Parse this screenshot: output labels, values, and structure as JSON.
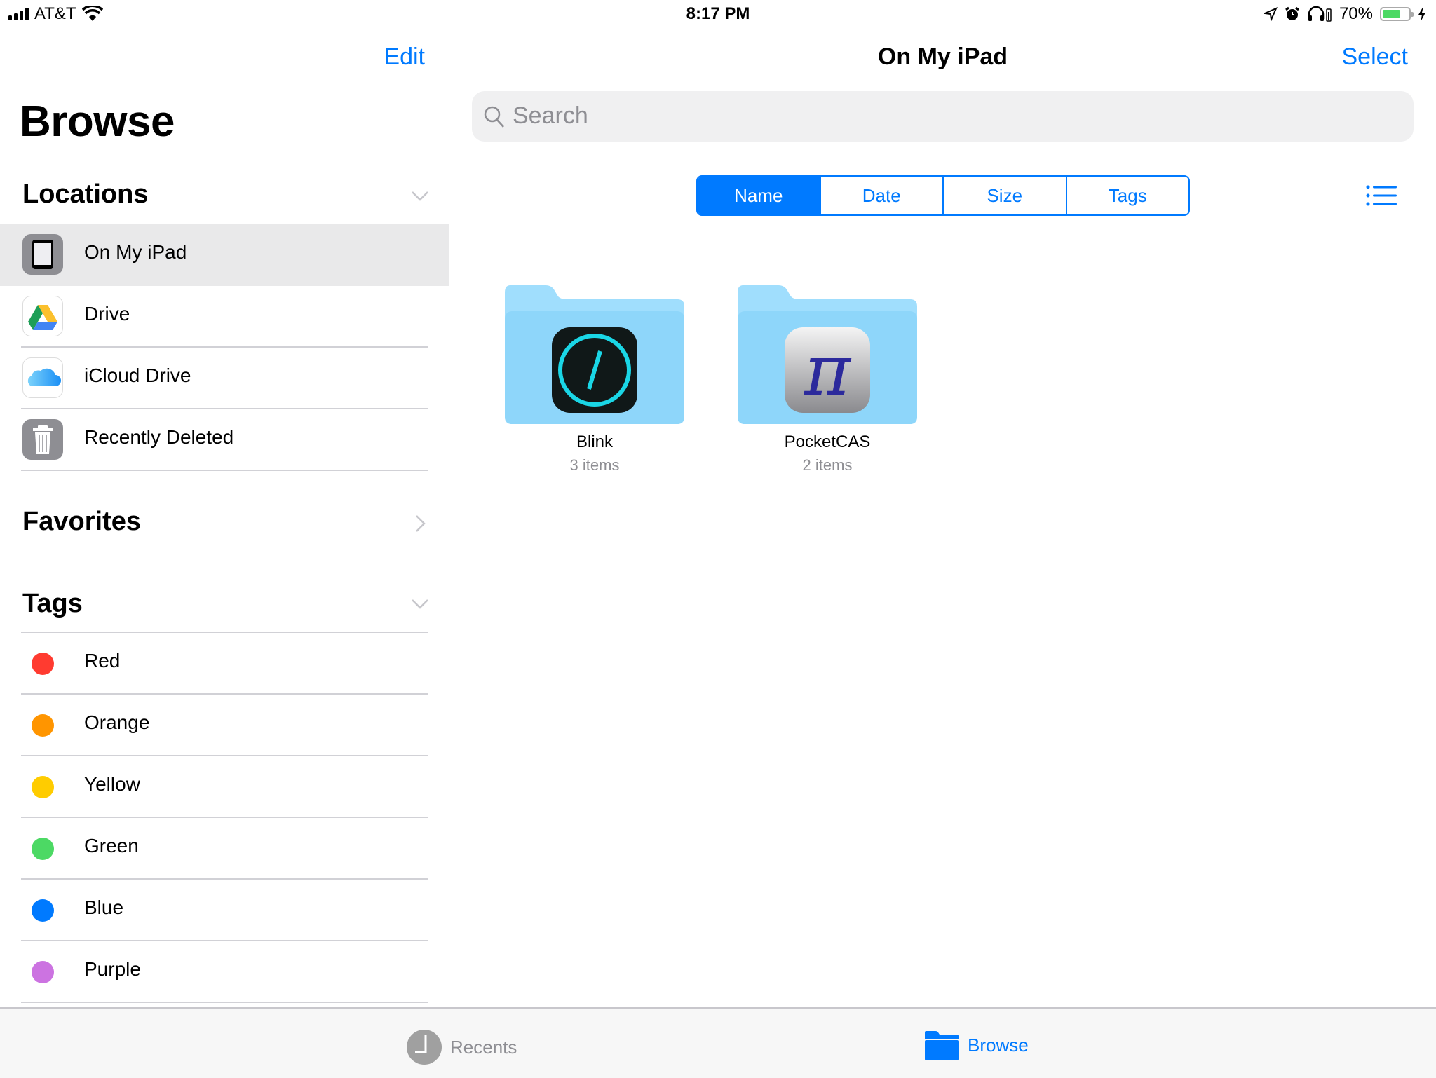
{
  "status_bar": {
    "carrier": "AT&T",
    "time": "8:17 PM",
    "battery_percent_label": "70%",
    "battery_level": 0.7,
    "icons": [
      "signal-icon",
      "wifi-icon",
      "location-arrow-icon",
      "alarm-icon",
      "headphones-icon",
      "charging-bolt-icon"
    ]
  },
  "sidebar": {
    "edit_label": "Edit",
    "title": "Browse",
    "locations": {
      "heading": "Locations",
      "items": [
        {
          "label": "On My iPad",
          "icon": "ipad-icon",
          "selected": true
        },
        {
          "label": "Drive",
          "icon": "google-drive-icon",
          "selected": false
        },
        {
          "label": "iCloud Drive",
          "icon": "icloud-icon",
          "selected": false
        },
        {
          "label": "Recently Deleted",
          "icon": "trash-icon",
          "selected": false
        }
      ]
    },
    "favorites": {
      "heading": "Favorites"
    },
    "tags": {
      "heading": "Tags",
      "items": [
        {
          "label": "Red",
          "color": "#ff3b30"
        },
        {
          "label": "Orange",
          "color": "#ff9500"
        },
        {
          "label": "Yellow",
          "color": "#ffcc00"
        },
        {
          "label": "Green",
          "color": "#4cd964"
        },
        {
          "label": "Blue",
          "color": "#007aff"
        },
        {
          "label": "Purple",
          "color": "#cc73e1"
        }
      ]
    }
  },
  "main": {
    "title": "On My iPad",
    "select_label": "Select",
    "search_placeholder": "Search",
    "sort": {
      "options": [
        "Name",
        "Date",
        "Size",
        "Tags"
      ],
      "selected": "Name"
    },
    "folders": [
      {
        "name": "Blink",
        "count": "3 items",
        "app_icon": "blink-app-icon"
      },
      {
        "name": "PocketCAS",
        "count": "2 items",
        "app_icon": "pocketcas-pi-icon"
      }
    ]
  },
  "tab_bar": {
    "tabs": [
      {
        "label": "Recents",
        "icon": "clock-icon",
        "active": false
      },
      {
        "label": "Browse",
        "icon": "folder-icon",
        "active": true
      }
    ]
  },
  "colors": {
    "accent": "#007aff",
    "folder": "#8ed6fa",
    "selected_row": "#e9e9ea"
  }
}
